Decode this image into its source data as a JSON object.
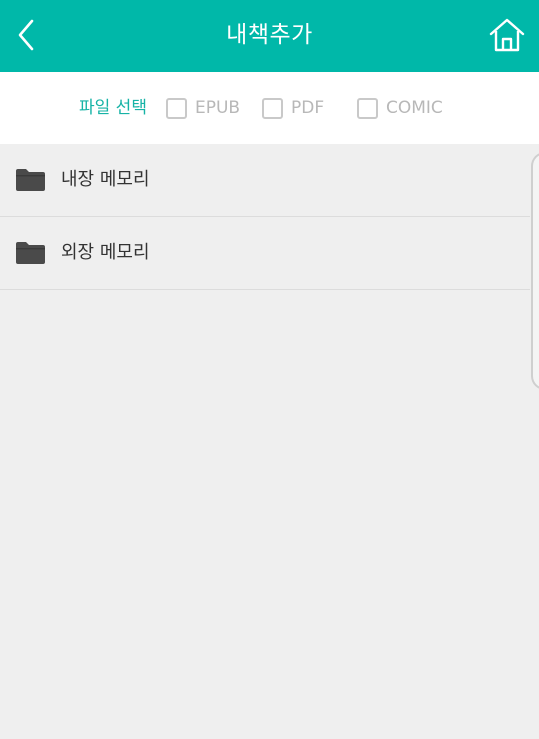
{
  "header": {
    "title": "내책추가",
    "back_icon": "chevron-left-icon",
    "home_icon": "home-icon",
    "bg_color": "#00b8a9"
  },
  "filter": {
    "label": "파일 선택",
    "label_color": "#16b3a6",
    "options": [
      {
        "label": "EPUB",
        "checked": false
      },
      {
        "label": "PDF",
        "checked": false
      },
      {
        "label": "COMIC",
        "checked": false
      }
    ]
  },
  "storage": {
    "items": [
      {
        "label": "내장 메모리",
        "icon": "folder-icon"
      },
      {
        "label": "외장 메모리",
        "icon": "folder-icon"
      }
    ]
  }
}
